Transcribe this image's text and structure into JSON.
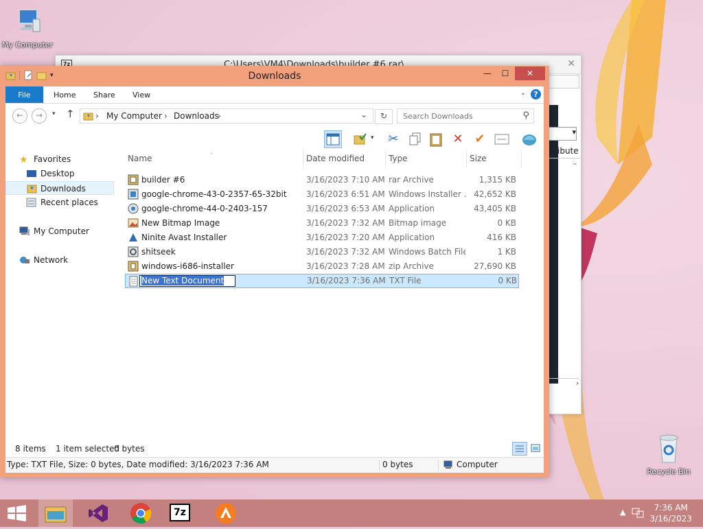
{
  "desktop": {
    "icons": [
      {
        "label": "My Computer"
      },
      {
        "label": "Recycle Bin"
      }
    ]
  },
  "bg_window": {
    "title": "C:\\Users\\VM4\\Downloads\\builder #6.rar\\",
    "close_glyph": "✕",
    "partial_column": "ibute",
    "partial_combo": "▾",
    "scroll_right": "›",
    "mark": "^"
  },
  "explorer": {
    "title": "Downloads",
    "window_buttons": {
      "minimize": "—",
      "maximize": "☐",
      "close": "✕"
    },
    "ribbon_tabs": [
      "File",
      "Home",
      "Share",
      "View"
    ],
    "help": "?",
    "ribbon_expand": "⌄",
    "nav": {
      "back": "←",
      "forward": "→",
      "recent": "▾",
      "up": "↑"
    },
    "address": {
      "seg1": "My Computer",
      "seg2": "Downloads",
      "sep": "›",
      "dropdown": "⌄",
      "refresh": "↻"
    },
    "search": {
      "placeholder": "Search Downloads",
      "icon": "⚲"
    },
    "nav_pane": {
      "favorites": "Favorites",
      "desktop": "Desktop",
      "downloads": "Downloads",
      "recent": "Recent places",
      "computer": "My Computer",
      "network": "Network"
    },
    "columns": {
      "name": "Name",
      "date": "Date modified",
      "type": "Type",
      "size": "Size",
      "sort": "˄"
    },
    "files": [
      {
        "name": "builder #6",
        "date": "3/16/2023 7:10 AM",
        "type": "rar Archive",
        "size": "1,315 KB"
      },
      {
        "name": "google-chrome-43-0-2357-65-32bit",
        "date": "3/16/2023 6:51 AM",
        "type": "Windows Installer ...",
        "size": "42,652 KB"
      },
      {
        "name": "google-chrome-44-0-2403-157",
        "date": "3/16/2023 6:53 AM",
        "type": "Application",
        "size": "43,405 KB"
      },
      {
        "name": "New Bitmap Image",
        "date": "3/16/2023 7:32 AM",
        "type": "Bitmap image",
        "size": "0 KB"
      },
      {
        "name": "Ninite Avast Installer",
        "date": "3/16/2023 7:20 AM",
        "type": "Application",
        "size": "416 KB"
      },
      {
        "name": "shitseek",
        "date": "3/16/2023 7:32 AM",
        "type": "Windows Batch File",
        "size": "1 KB"
      },
      {
        "name": "windows-i686-installer",
        "date": "3/16/2023 7:28 AM",
        "type": "zip Archive",
        "size": "27,690 KB"
      },
      {
        "name": "New Text Document",
        "date": "3/16/2023 7:36 AM",
        "type": "TXT File",
        "size": "0 KB"
      }
    ],
    "status": {
      "items": "8 items",
      "selected": "1 item selected",
      "bytes": "0 bytes",
      "details": "Type: TXT File, Size: 0 bytes, Date modified: 3/16/2023 7:36 AM",
      "size2": "0 bytes",
      "location": "Computer"
    }
  },
  "taskbar": {
    "time": "7:36 AM",
    "date": "3/16/2023",
    "tray_arrow": "▲",
    "sevenzip_label": "7z"
  },
  "colors": {
    "accent": "#1979ca",
    "frame": "#f2a07b",
    "taskbar": "#c4807e",
    "close": "#c7504f"
  }
}
